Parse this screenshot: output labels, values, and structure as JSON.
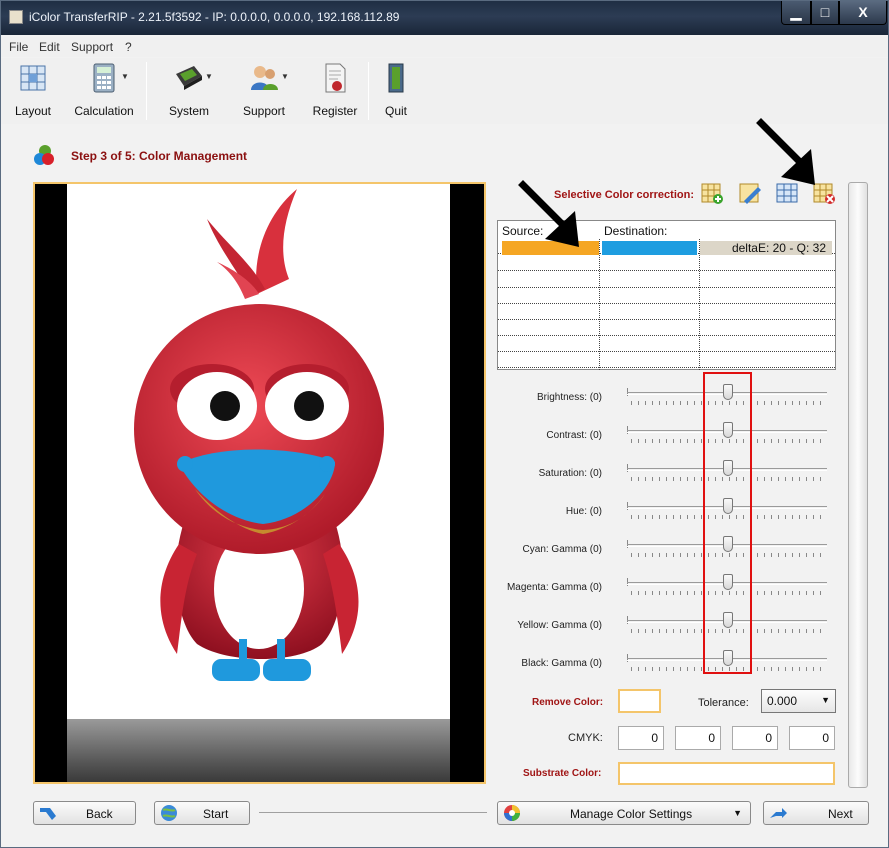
{
  "window": {
    "title": "iColor TransferRIP - 2.21.5f3592 - IP: 0.0.0.0, 0.0.0.0, 192.168.112.89",
    "controls": {
      "minimize": "▁",
      "maximize": "□",
      "close": "X"
    }
  },
  "menu": [
    "File",
    "Edit",
    "Support",
    "?"
  ],
  "toolbar": {
    "layout": "Layout",
    "calculation": "Calculation",
    "system": "System",
    "support": "Support",
    "register": "Register",
    "quit": "Quit"
  },
  "step": {
    "title": "Step 3 of 5: Color Management"
  },
  "selective": {
    "label": "Selective Color correction:",
    "columns": {
      "source": "Source:",
      "destination": "Destination:"
    },
    "row1": {
      "source_color": "#f5a623",
      "destination_color": "#1e9de0",
      "delta": "deltaE: 20 - Q: 32"
    }
  },
  "adjustments": [
    {
      "label": "Brightness: (0)",
      "value": 0
    },
    {
      "label": "Contrast: (0)",
      "value": 0
    },
    {
      "label": "Saturation: (0)",
      "value": 0
    },
    {
      "label": "Hue: (0)",
      "value": 0
    },
    {
      "label": "Cyan: Gamma  (0)",
      "value": 0
    },
    {
      "label": "Magenta: Gamma  (0)",
      "value": 0
    },
    {
      "label": "Yellow: Gamma  (0)",
      "value": 0
    },
    {
      "label": "Black: Gamma  (0)",
      "value": 0
    }
  ],
  "remove_color": {
    "label": "Remove Color:"
  },
  "tolerance": {
    "label": "Tolerance:",
    "value": "0.000"
  },
  "cmyk": {
    "label": "CMYK:",
    "c": "0",
    "m": "0",
    "y": "0",
    "k": "0"
  },
  "substrate": {
    "label": "Substrate Color:"
  },
  "buttons": {
    "back": "Back",
    "start": "Start",
    "manage": "Manage Color Settings",
    "next": "Next"
  },
  "colors": {
    "accent": "#a01515",
    "highlight": "#f4c56a",
    "annotation": "#e01010"
  }
}
